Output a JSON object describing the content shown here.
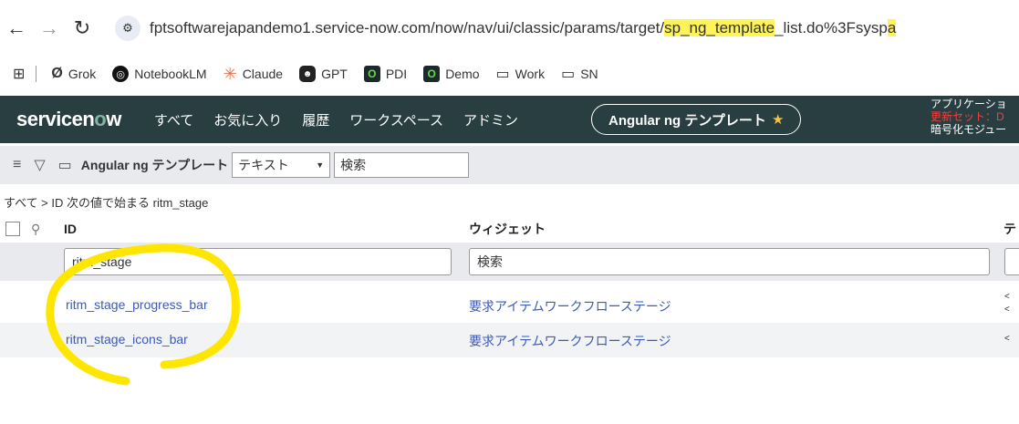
{
  "browser": {
    "url_prefix": "fptsoftwarejapandemo1.service-now.com/now/nav/ui/classic/params/target/",
    "url_highlight": "sp_ng_template",
    "url_suffix": "_list.do%3Fsysp",
    "url_tail": "a"
  },
  "bookmarks": [
    {
      "label": "Grok",
      "icon": "grok-icon"
    },
    {
      "label": "NotebookLM",
      "icon": "notebooklm-icon"
    },
    {
      "label": "Claude",
      "icon": "claude-icon"
    },
    {
      "label": "GPT",
      "icon": "gpt-icon"
    },
    {
      "label": "PDI",
      "icon": "pdi-icon"
    },
    {
      "label": "Demo",
      "icon": "demo-icon"
    },
    {
      "label": "Work",
      "icon": "folder-icon"
    },
    {
      "label": "SN",
      "icon": "folder-icon"
    }
  ],
  "header": {
    "logo_pre": "servicen",
    "logo_o": "o",
    "logo_post": "w",
    "nav": [
      "すべて",
      "お気に入り",
      "履歴",
      "ワークスペース",
      "アドミン"
    ],
    "pill": "Angular ng テンプレート",
    "right_line1": "アプリケーショ",
    "right_line2": "更新セット：D",
    "right_line3": "暗号化モジュー"
  },
  "toolbar": {
    "title": "Angular ng テンプレート",
    "select_value": "テキスト",
    "search_value": "検索"
  },
  "breadcrumb": "すべて > ID 次の値で始まる ritm_stage",
  "columns": {
    "id": "ID",
    "widget": "ウィジェット",
    "third": "テ"
  },
  "filters": {
    "id_value": "ritm_stage",
    "widget_value": "検索"
  },
  "rows": [
    {
      "id": "ritm_stage_progress_bar",
      "widget": "要求アイテムワークフローステージ",
      "extra": "<"
    },
    {
      "id": "ritm_stage_icons_bar",
      "widget": "要求アイテムワークフローステージ",
      "extra": "<"
    }
  ],
  "colors": {
    "header_bg": "#293e40",
    "highlight": "#fff35c",
    "annotation": "#ffe600",
    "link": "#3c5ab8"
  }
}
